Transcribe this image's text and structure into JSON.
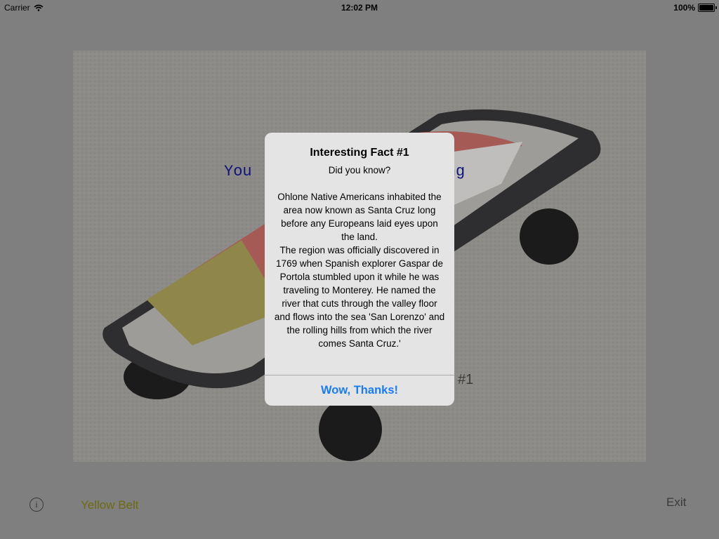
{
  "status_bar": {
    "carrier": "Carrier",
    "time": "12:02 PM",
    "battery": "100%"
  },
  "background": {
    "text_line_1": "You",
    "text_line_1_tail": "sting",
    "fact_tag": "#1"
  },
  "alert": {
    "title": "Interesting Fact #1",
    "message": "Did you know?\n\nOhlone Native Americans inhabited the area now known as Santa Cruz long before any Europeans laid eyes upon the land.\nThe region was officially discovered in 1769 when Spanish explorer Gaspar de Portola stumbled upon it while he was traveling to Monterey. He named the river that cuts through the valley floor and flows into the sea 'San Lorenzo' and the rolling hills from which the river comes Santa Cruz.'",
    "button_label": "Wow, Thanks!"
  },
  "bottom_bar": {
    "info_glyph": "i",
    "belt_label": "Yellow Belt",
    "exit_label": "Exit"
  },
  "colors": {
    "overlay": "#7f7f7f",
    "alert_button": "#1a7cf5",
    "belt_label": "#6e6a12",
    "background_text": "#10127a"
  }
}
